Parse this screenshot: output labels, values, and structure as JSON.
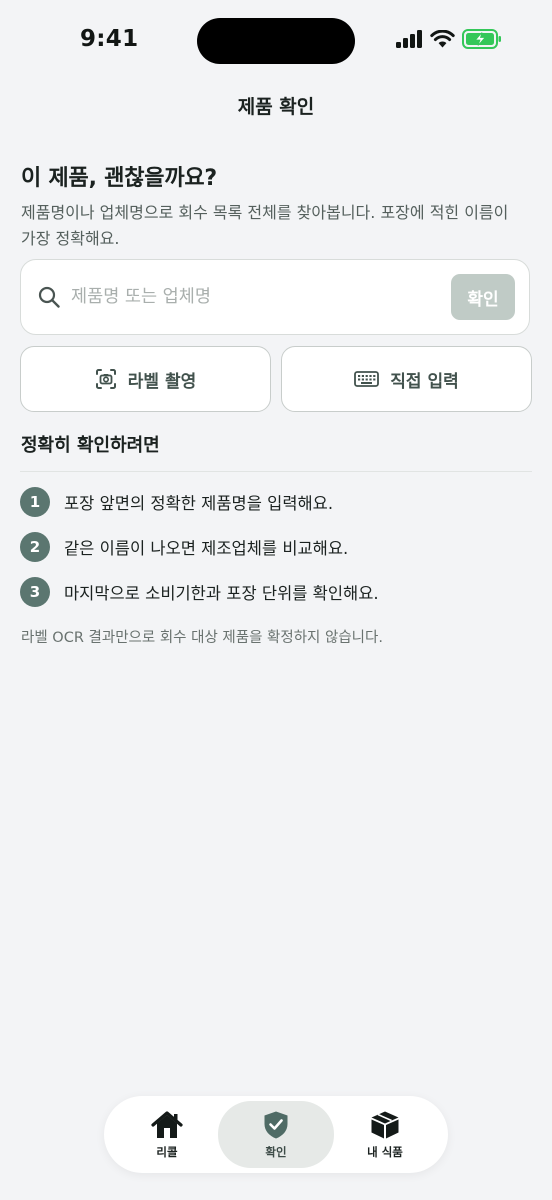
{
  "status_bar": {
    "time": "9:41",
    "signal_icon": "cellular-signal-icon",
    "wifi_icon": "wifi-icon",
    "battery_icon": "battery-charging-icon"
  },
  "header": {
    "title": "제품 확인"
  },
  "hero": {
    "title": "이 제품, 괜찮을까요?",
    "subtitle": "제품명이나 업체명으로 회수 목록 전체를 찾아봅니다. 포장에 적힌 이름이 가장 정확해요."
  },
  "search": {
    "icon": "search-icon",
    "value": "",
    "placeholder": "제품명 또는 업체명",
    "button_label": "확인"
  },
  "methods": {
    "camera": {
      "icon": "camera-scan-icon",
      "label": "라벨 촬영"
    },
    "manual": {
      "icon": "keyboard-icon",
      "label": "직접 입력"
    }
  },
  "guide": {
    "title": "정확히 확인하려면",
    "steps": [
      {
        "number": "1",
        "text": "포장 앞면의 정확한 제품명을 입력해요."
      },
      {
        "number": "2",
        "text": "같은 이름이 나오면 제조업체를 비교해요."
      },
      {
        "number": "3",
        "text": "마지막으로 소비기한과 포장 단위를 확인해요."
      }
    ],
    "footnote": "라벨 OCR 결과만으로 회수 대상 제품을 확정하지 않습니다."
  },
  "tab_bar": {
    "tabs": [
      {
        "icon": "home-icon",
        "label": "리콜",
        "active": false
      },
      {
        "icon": "shield-check-icon",
        "label": "확인",
        "active": true
      },
      {
        "icon": "package-icon",
        "label": "내 식품",
        "active": false
      }
    ]
  },
  "colors": {
    "background": "#f3f4f6",
    "accent": "#5b7670",
    "button_disabled": "#c0cbc6",
    "battery_charging": "#34c759"
  }
}
